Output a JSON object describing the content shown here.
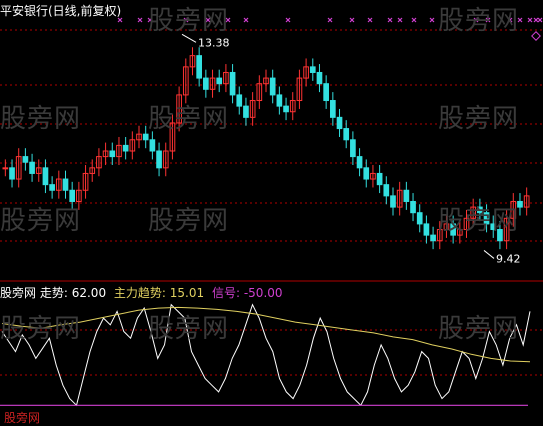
{
  "title": "平安银行(日线,前复权)",
  "watermark": "股旁网",
  "price_panel": {
    "high_label": "13.38",
    "low_label": "9.42"
  },
  "indicator_panel": {
    "name": "股旁网",
    "trend_label": "走势:",
    "trend_value": "62.00",
    "main_label": "主力趋势:",
    "main_value": "15.01",
    "signal_label": "信号:",
    "signal_value": "-50.00",
    "bottom_text": "股旁网"
  },
  "colors": {
    "up": "#ff3333",
    "down": "#33e0e0",
    "grid": "#b00000",
    "trend_line": "#ffffff",
    "main_line": "#e0d060",
    "signal_line": "#d040d0",
    "marker": "#d040d0",
    "label": "#ffffff"
  },
  "chart_data": {
    "type": "candlestick",
    "ylim": [
      9.0,
      13.6
    ],
    "high_value": 13.38,
    "low_value": 9.42,
    "closes": [
      11.0,
      10.8,
      11.2,
      11.1,
      10.9,
      11.0,
      10.7,
      10.6,
      10.8,
      10.6,
      10.4,
      10.6,
      10.9,
      11.0,
      11.2,
      11.3,
      11.2,
      11.4,
      11.3,
      11.5,
      11.6,
      11.5,
      11.3,
      11.0,
      11.3,
      11.8,
      12.3,
      12.8,
      13.0,
      12.6,
      12.4,
      12.6,
      12.5,
      12.7,
      12.3,
      12.1,
      11.9,
      12.2,
      12.5,
      12.6,
      12.3,
      12.1,
      12.0,
      12.2,
      12.6,
      12.8,
      12.7,
      12.5,
      12.2,
      11.9,
      11.7,
      11.5,
      11.2,
      11.0,
      10.8,
      10.9,
      10.7,
      10.5,
      10.3,
      10.6,
      10.4,
      10.2,
      10.0,
      9.8,
      9.7,
      9.9,
      10.0,
      9.8,
      9.9,
      10.1,
      10.3,
      10.2,
      10.0,
      9.9,
      9.7,
      10.1,
      10.4,
      10.3,
      10.5
    ],
    "trend_ylim": [
      -60,
      110
    ],
    "trend": [
      60,
      45,
      30,
      55,
      40,
      20,
      35,
      50,
      10,
      -20,
      -40,
      -50,
      -10,
      30,
      60,
      80,
      70,
      90,
      60,
      50,
      80,
      95,
      60,
      20,
      40,
      100,
      90,
      80,
      30,
      10,
      -10,
      -20,
      -30,
      -10,
      20,
      40,
      70,
      100,
      80,
      50,
      30,
      -10,
      -30,
      -40,
      -20,
      10,
      50,
      80,
      60,
      20,
      -10,
      -30,
      -40,
      -50,
      -30,
      10,
      40,
      20,
      -10,
      -30,
      -20,
      0,
      30,
      20,
      -20,
      -40,
      -30,
      0,
      30,
      20,
      -10,
      20,
      60,
      40,
      10,
      50,
      70,
      40,
      90
    ]
  }
}
